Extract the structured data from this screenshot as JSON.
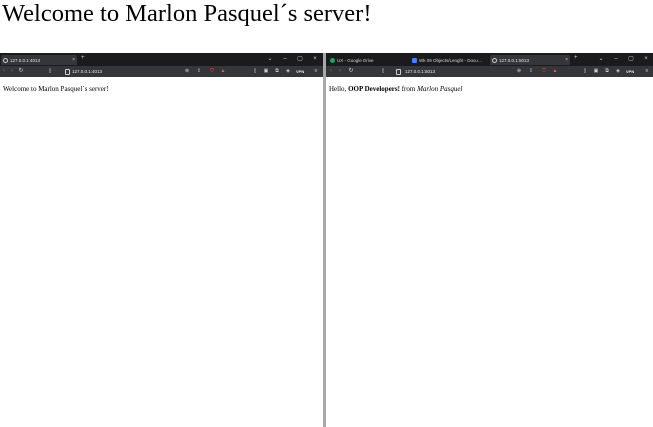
{
  "page": {
    "heading": "Welcome to Marlon Pasquel´s server!"
  },
  "left_window": {
    "tabs": [
      {
        "title": "127.0.0.1:4013",
        "close": "×",
        "active": true
      }
    ],
    "new_tab": "+",
    "controls": {
      "tab_search": "⌄",
      "minimize": "–",
      "maximize": "▢",
      "close": "×"
    },
    "address": "127.0.0.1:4013",
    "vpn_label": "VPN",
    "content_text": "Welcome to Marlon Pasquel´s server!"
  },
  "right_window": {
    "tabs": [
      {
        "title": "UX - Google Drive",
        "active": false
      },
      {
        "title": "Wk 09 Objects/Lenght - Documen",
        "active": false
      },
      {
        "title": "127.0.0.1:5013",
        "close": "×",
        "active": true
      }
    ],
    "new_tab": "+",
    "controls": {
      "tab_search": "⌄",
      "minimize": "–",
      "maximize": "▢",
      "close": "×"
    },
    "address": "127.0.0.1:5013",
    "vpn_label": "VPN",
    "content": {
      "greeting": "Hello,",
      "bold": "OOP Developers!",
      "from": "from",
      "italic": "Marlon Pasquel"
    }
  },
  "icons": {
    "back": "‹",
    "forward": "›",
    "reload": "↻",
    "zoom": "⊕",
    "share": "⇪",
    "shield": "⛉",
    "rewards": "▲",
    "sidebar": "▯",
    "wallet": "▣",
    "extensions": "⧉",
    "menu": "≡"
  }
}
